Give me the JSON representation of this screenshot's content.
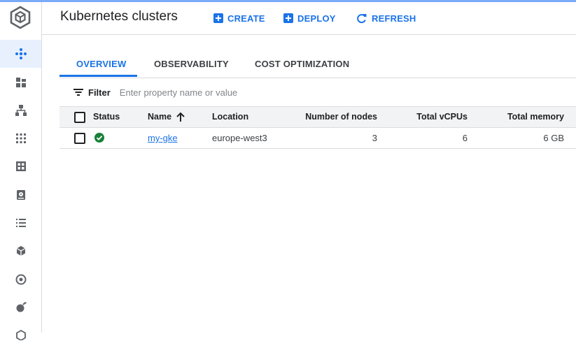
{
  "app": {
    "title": "Kubernetes clusters",
    "accent_color": "#1a73e8",
    "status_ok_color": "#188038"
  },
  "toolbar": {
    "create_label": "CREATE",
    "deploy_label": "DEPLOY",
    "refresh_label": "REFRESH"
  },
  "tabs": [
    {
      "label": "OVERVIEW",
      "active": true
    },
    {
      "label": "OBSERVABILITY",
      "active": false
    },
    {
      "label": "COST OPTIMIZATION",
      "active": false
    }
  ],
  "filter": {
    "label": "Filter",
    "placeholder": "Enter property name or value"
  },
  "table": {
    "columns": [
      "Status",
      "Name",
      "Location",
      "Number of nodes",
      "Total vCPUs",
      "Total memory"
    ],
    "sort": {
      "column": "Name",
      "direction": "ascending"
    },
    "rows": [
      {
        "status": "ok",
        "name": "my-gke",
        "location": "europe-west3",
        "nodes": "3",
        "vcpus": "6",
        "memory": "6 GB"
      }
    ]
  },
  "sidebar": {
    "icons": [
      "clusters-icon",
      "workloads-icon",
      "services-icon",
      "apps-icon",
      "secrets-icon",
      "storage-icon",
      "object-browser-icon",
      "migrate-icon",
      "config-icon",
      "marketplace-icon",
      "more-icon"
    ]
  }
}
